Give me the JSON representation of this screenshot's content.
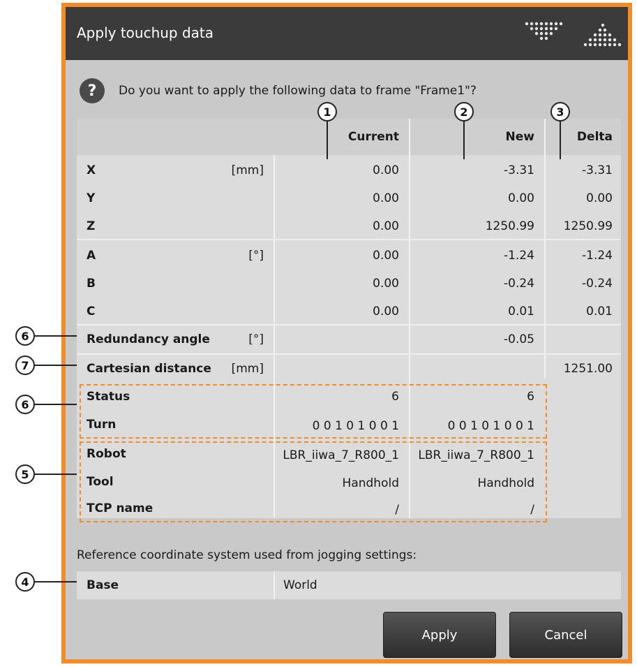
{
  "dialog": {
    "title": "Apply touchup data",
    "question": "Do you want to apply the following data to frame \"Frame1\"?",
    "question_icon": "?"
  },
  "columns": {
    "current": "Current",
    "new": "New",
    "delta": "Delta"
  },
  "rows": [
    {
      "label": "X",
      "unit": "[mm]",
      "current": "0.00",
      "new": "-3.31",
      "delta": "-3.31"
    },
    {
      "label": "Y",
      "unit": "",
      "current": "0.00",
      "new": "0.00",
      "delta": "0.00"
    },
    {
      "label": "Z",
      "unit": "",
      "current": "0.00",
      "new": "1250.99",
      "delta": "1250.99"
    },
    {
      "label": "A",
      "unit": "[°]",
      "current": "0.00",
      "new": "-1.24",
      "delta": "-1.24"
    },
    {
      "label": "B",
      "unit": "",
      "current": "0.00",
      "new": "-0.24",
      "delta": "-0.24"
    },
    {
      "label": "C",
      "unit": "",
      "current": "0.00",
      "new": "0.01",
      "delta": "0.01"
    },
    {
      "label": "Redundancy angle",
      "unit": "[°]",
      "current": "",
      "new": "-0.05",
      "delta": ""
    },
    {
      "label": "Cartesian distance",
      "unit": "[mm]",
      "current": "",
      "new": "",
      "delta": "1251.00"
    },
    {
      "label": "Status",
      "unit": "",
      "current": "6",
      "new": "6",
      "delta": ""
    },
    {
      "label": "Turn",
      "unit": "",
      "current": "0 0 1 0 1 0 0 1",
      "new": "0 0 1 0 1 0 0 1",
      "delta": ""
    },
    {
      "label": "Robot",
      "unit": "",
      "current": "LBR_iiwa_7_R800_1",
      "new": "LBR_iiwa_7_R800_1",
      "delta": ""
    },
    {
      "label": "Tool",
      "unit": "",
      "current": "Handhold",
      "new": "Handhold",
      "delta": ""
    },
    {
      "label": "TCP name",
      "unit": "",
      "current": "/",
      "new": "/",
      "delta": ""
    }
  ],
  "reference": {
    "label": "Reference coordinate system used from jogging settings:",
    "key": "Base",
    "value": "World"
  },
  "buttons": {
    "apply": "Apply",
    "cancel": "Cancel"
  },
  "callouts": {
    "current": "1",
    "new": "2",
    "delta": "3",
    "reference": "4",
    "robot_group": "5",
    "redundancy": "6",
    "status_group": "6",
    "cartesian": "7"
  },
  "colors": {
    "accent": "#f28c28",
    "title_bar": "#3b3b3b",
    "button": "#3a3a3a"
  }
}
